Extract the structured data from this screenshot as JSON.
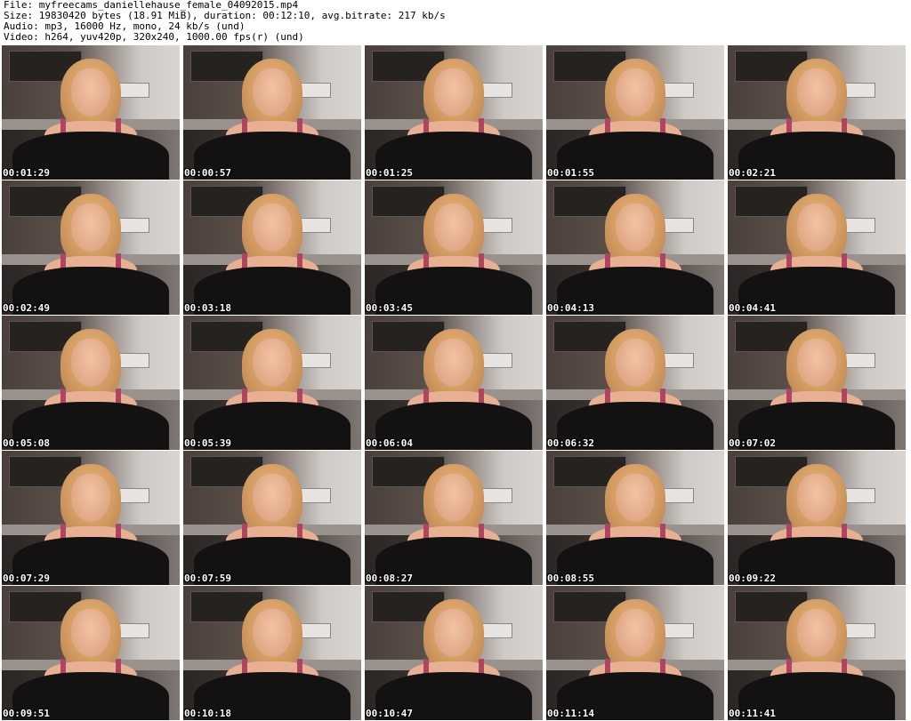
{
  "header": {
    "file_line": "File: myfreecams_daniellehause_female_04092015.mp4",
    "size_line": "Size: 19830420 bytes (18.91 MiB), duration: 00:12:10, avg.bitrate: 217 kb/s",
    "audio_line": "Audio: mp3, 16000 Hz, mono, 24 kb/s (und)",
    "video_line": "Video: h264, yuv420p, 320x240, 1000.00 fps(r) (und)"
  },
  "thumbnails": [
    {
      "timestamp": "00:01:29"
    },
    {
      "timestamp": "00:00:57"
    },
    {
      "timestamp": "00:01:25"
    },
    {
      "timestamp": "00:01:55"
    },
    {
      "timestamp": "00:02:21"
    },
    {
      "timestamp": "00:02:49"
    },
    {
      "timestamp": "00:03:18"
    },
    {
      "timestamp": "00:03:45"
    },
    {
      "timestamp": "00:04:13"
    },
    {
      "timestamp": "00:04:41"
    },
    {
      "timestamp": "00:05:08"
    },
    {
      "timestamp": "00:05:39"
    },
    {
      "timestamp": "00:06:04"
    },
    {
      "timestamp": "00:06:32"
    },
    {
      "timestamp": "00:07:02"
    },
    {
      "timestamp": "00:07:29"
    },
    {
      "timestamp": "00:07:59"
    },
    {
      "timestamp": "00:08:27"
    },
    {
      "timestamp": "00:08:55"
    },
    {
      "timestamp": "00:09:22"
    },
    {
      "timestamp": "00:09:51"
    },
    {
      "timestamp": "00:10:18"
    },
    {
      "timestamp": "00:10:47"
    },
    {
      "timestamp": "00:11:14"
    },
    {
      "timestamp": "00:11:41"
    }
  ]
}
